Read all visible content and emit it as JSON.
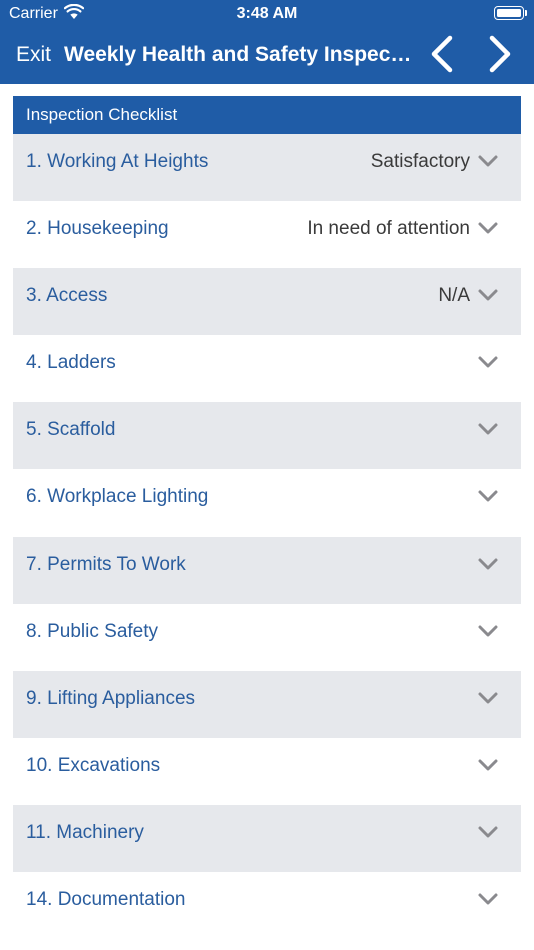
{
  "status_bar": {
    "carrier": "Carrier",
    "time": "3:48 AM"
  },
  "nav": {
    "exit_label": "Exit",
    "title": "Weekly Health and Safety Inspection",
    "prev_icon": "chevron-left-icon",
    "next_icon": "chevron-right-icon"
  },
  "checklist": {
    "header": "Inspection Checklist",
    "items": [
      {
        "label": "1. Working At Heights",
        "value": "Satisfactory"
      },
      {
        "label": "2. Housekeeping",
        "value": "In need of attention"
      },
      {
        "label": "3. Access",
        "value": "N/A"
      },
      {
        "label": "4. Ladders",
        "value": ""
      },
      {
        "label": "5. Scaffold",
        "value": ""
      },
      {
        "label": "6. Workplace Lighting",
        "value": ""
      },
      {
        "label": "7. Permits To Work",
        "value": ""
      },
      {
        "label": "8. Public Safety",
        "value": ""
      },
      {
        "label": "9. Lifting Appliances",
        "value": ""
      },
      {
        "label": "10. Excavations",
        "value": ""
      },
      {
        "label": "11. Machinery",
        "value": ""
      },
      {
        "label": "14. Documentation",
        "value": ""
      }
    ]
  },
  "colors": {
    "brand": "#1f5ca7",
    "item_text": "#2a5d9e",
    "row_shade": "#e6e8ec",
    "chevron": "#8a8a8e"
  }
}
